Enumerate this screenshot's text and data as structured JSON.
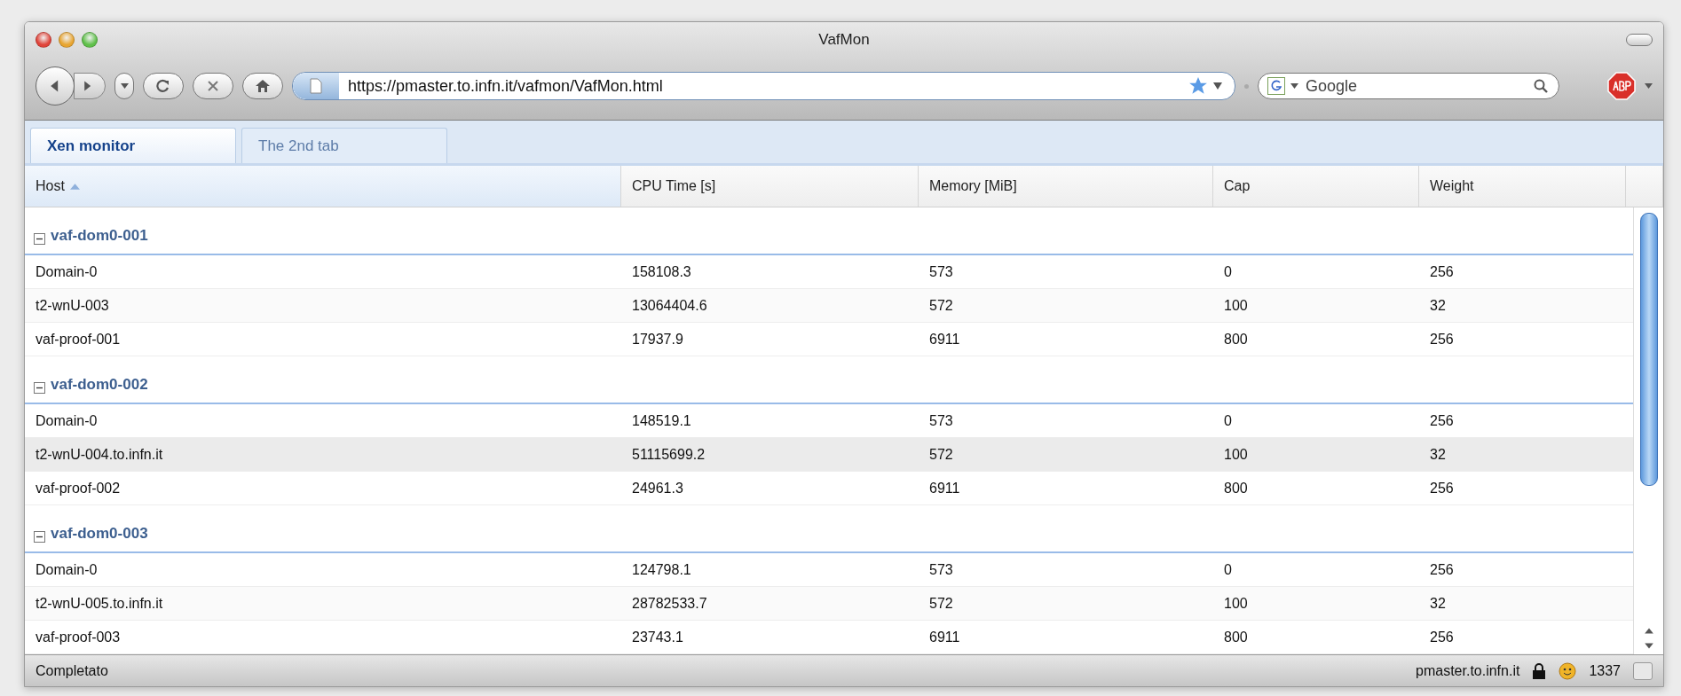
{
  "window": {
    "title": "VafMon"
  },
  "toolbar": {
    "url": "https://pmaster.to.infn.it/vafmon/VafMon.html",
    "search": {
      "placeholder": "Google"
    }
  },
  "tabs": [
    {
      "label": "Xen monitor",
      "selected": true
    },
    {
      "label": "The 2nd tab",
      "selected": false
    }
  ],
  "table": {
    "columns": [
      {
        "label": "Host",
        "sorted": true
      },
      {
        "label": "CPU Time [s]",
        "sorted": false
      },
      {
        "label": "Memory [MiB]",
        "sorted": false
      },
      {
        "label": "Cap",
        "sorted": false
      },
      {
        "label": "Weight",
        "sorted": false
      }
    ],
    "groups": [
      {
        "name": "vaf-dom0-001",
        "expanded": true,
        "rows": [
          {
            "cells": [
              "Domain-0",
              "158108.3",
              "573",
              "0",
              "256"
            ],
            "selected": false
          },
          {
            "cells": [
              "t2-wnU-003",
              "13064404.6",
              "572",
              "100",
              "32"
            ],
            "selected": false
          },
          {
            "cells": [
              "vaf-proof-001",
              "17937.9",
              "6911",
              "800",
              "256"
            ],
            "selected": false
          }
        ]
      },
      {
        "name": "vaf-dom0-002",
        "expanded": true,
        "rows": [
          {
            "cells": [
              "Domain-0",
              "148519.1",
              "573",
              "0",
              "256"
            ],
            "selected": false
          },
          {
            "cells": [
              "t2-wnU-004.to.infn.it",
              "51115699.2",
              "572",
              "100",
              "32"
            ],
            "selected": true
          },
          {
            "cells": [
              "vaf-proof-002",
              "24961.3",
              "6911",
              "800",
              "256"
            ],
            "selected": false
          }
        ]
      },
      {
        "name": "vaf-dom0-003",
        "expanded": true,
        "rows": [
          {
            "cells": [
              "Domain-0",
              "124798.1",
              "573",
              "0",
              "256"
            ],
            "selected": false
          },
          {
            "cells": [
              "t2-wnU-005.to.infn.it",
              "28782533.7",
              "572",
              "100",
              "32"
            ],
            "selected": false
          },
          {
            "cells": [
              "vaf-proof-003",
              "23743.1",
              "6911",
              "800",
              "256"
            ],
            "selected": false
          }
        ]
      }
    ]
  },
  "status_bar": {
    "text": "Completato",
    "host": "pmaster.to.infn.it",
    "count": "1337"
  }
}
